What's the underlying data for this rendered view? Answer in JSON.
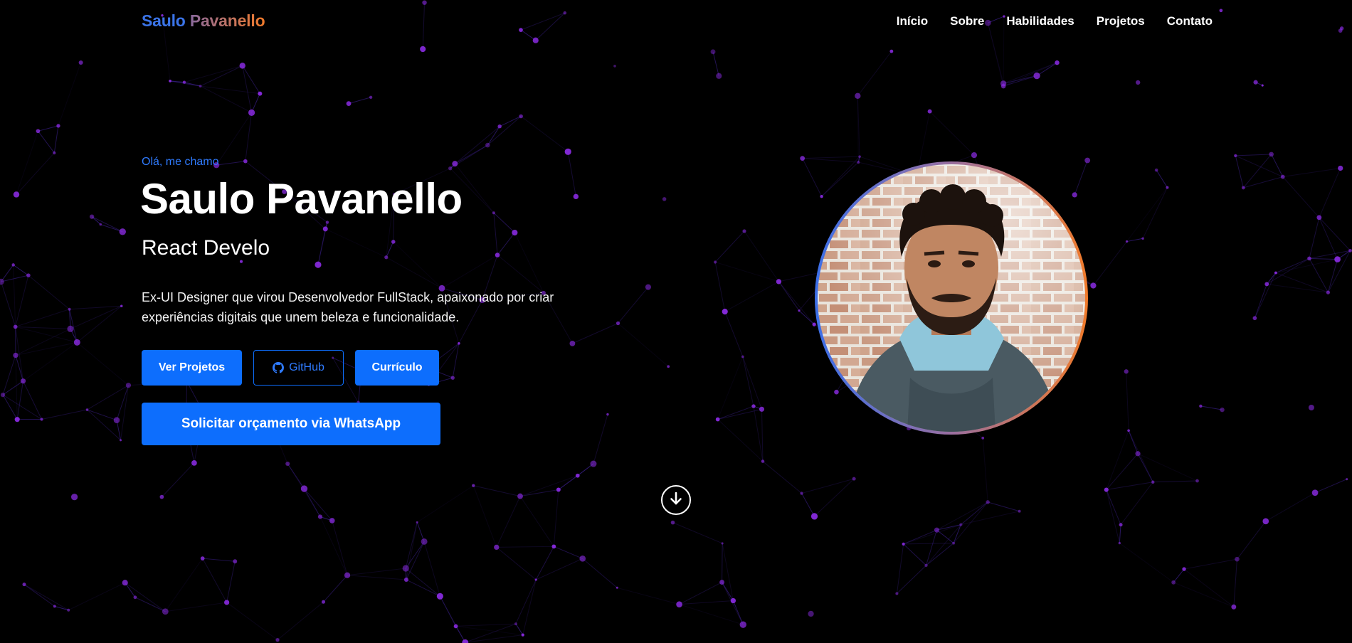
{
  "header": {
    "brand_first": "Saulo",
    "brand_last": "Pavanello",
    "nav": [
      "Início",
      "Sobre",
      "Habilidades",
      "Projetos",
      "Contato"
    ]
  },
  "hero": {
    "greeting": "Olá, me chamo",
    "name": "Saulo Pavanello",
    "role": "React Develo",
    "bio": "Ex-UI Designer que virou Desenvolvedor FullStack, apaixonado por criar experiências digitais que unem beleza e funcionalidade.",
    "buttons": {
      "projects": "Ver Projetos",
      "github": "GitHub",
      "resume": "Currículo",
      "whatsapp": "Solicitar orçamento via WhatsApp"
    }
  },
  "icons": {
    "github": "github-icon",
    "scroll": "arrow-down-circle-icon"
  },
  "colors": {
    "background": "#000000",
    "accent": "#0d6efd",
    "brand_blue": "#3b74e8",
    "brand_orange": "#f07a2a",
    "network_node": "#8a2be2",
    "network_line": "#3a1f8a"
  }
}
